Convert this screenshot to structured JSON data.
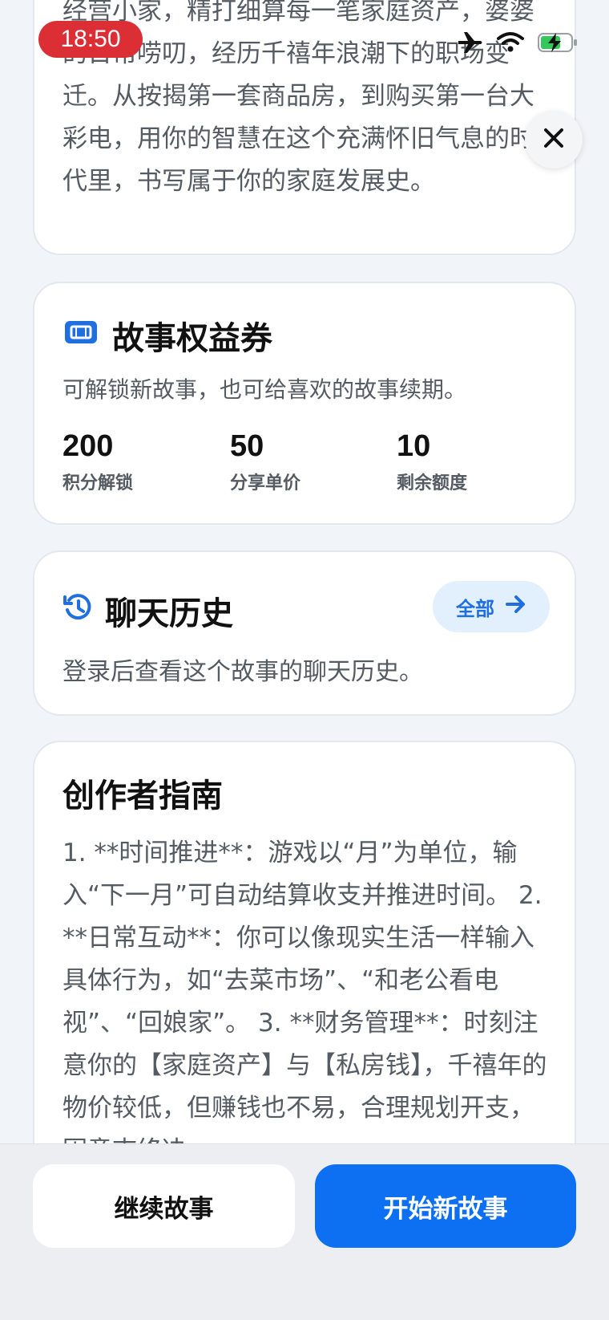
{
  "status_bar": {
    "time": "18:50"
  },
  "intro": {
    "text": "经营小家，精打细算每一笔家庭资产，婆婆的日常唠叨，经历千禧年浪潮下的职场变迁。从按揭第一套商品房，到购买第一台大彩电，用你的智慧在这个充满怀旧气息的时代里，书写属于你的家庭发展史。"
  },
  "voucher": {
    "icon": "ticket-icon",
    "title": "故事权益券",
    "description": "可解锁新故事，也可给喜欢的故事续期。",
    "stats": [
      {
        "value": "200",
        "label": "积分解锁"
      },
      {
        "value": "50",
        "label": "分享单价"
      },
      {
        "value": "10",
        "label": "剩余额度"
      }
    ]
  },
  "history": {
    "icon": "history-icon",
    "title": "聊天历史",
    "all_label": "全部",
    "description": "登录后查看这个故事的聊天历史。"
  },
  "guide": {
    "title": "创作者指南",
    "text": "1. **时间推进**：游戏以“月”为单位，输入“下一月”可自动结算收支并推进时间。 2. **日常互动**：你可以像现实生活一样输入具体行为，如“去菜市场”、“和老公看电视”、“回娘家”。 3. **财务管理**：时刻注意你的【家庭资产】与【私房钱】，千禧年的物价较低，但赚钱也不易，合理规划开支，因意志终决"
  },
  "actions": {
    "continue_label": "继续故事",
    "new_label": "开始新故事"
  },
  "colors": {
    "accent": "#0d6ff2",
    "time_pill": "#dc2f35",
    "chip_bg": "#e2f0fd"
  }
}
